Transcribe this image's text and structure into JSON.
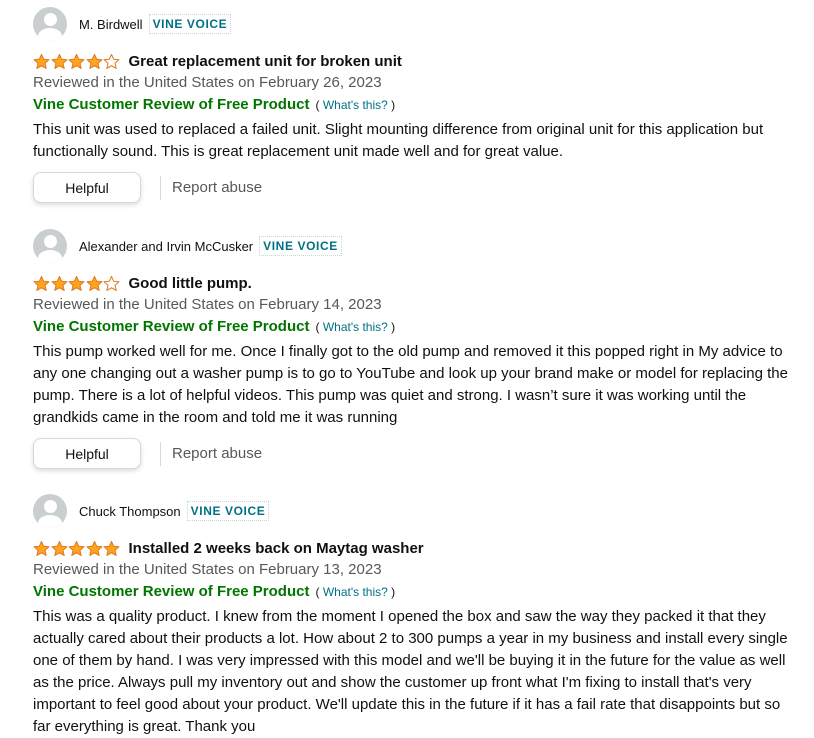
{
  "colors": {
    "star": "#ffa41c",
    "star_outline": "#de7921",
    "vine_badge": "#007185",
    "vine_label": "#007600",
    "date": "#565959"
  },
  "icons": {
    "avatar": "default-avatar-icon",
    "star_full": "star-full-icon",
    "star_empty": "star-empty-icon"
  },
  "reviews": [
    {
      "author": "M. Birdwell",
      "badge": "VINE VOICE",
      "rating": 4,
      "title": "Great replacement unit for broken unit",
      "date": "Reviewed in the United States on February 26, 2023",
      "vine_label": "Vine Customer Review of Free Product",
      "whats_open": "(",
      "whats_link": "What's this?",
      "whats_close": ")",
      "body": "This unit was used to replaced a failed unit. Slight mounting difference from original unit for this application but functionally sound. This is great replacement unit made well and for great value.",
      "helpful_label": "Helpful",
      "report_label": "Report abuse"
    },
    {
      "author": "Alexander and Irvin McCusker",
      "badge": "VINE VOICE",
      "rating": 4,
      "title": "Good little pump.",
      "date": "Reviewed in the United States on February 14, 2023",
      "vine_label": "Vine Customer Review of Free Product",
      "whats_open": "(",
      "whats_link": "What's this?",
      "whats_close": ")",
      "body": "This pump worked well for me. Once I finally got to the old pump and removed it this popped right in My advice to any one changing out a washer pump is to go to YouTube and look up your brand make or model for replacing the pump. There is a lot of helpful videos. This pump was quiet and strong. I wasn’t sure it was working until the grandkids came in the room and told me it was running",
      "helpful_label": "Helpful",
      "report_label": "Report abuse"
    },
    {
      "author": "Chuck Thompson",
      "badge": "VINE VOICE",
      "rating": 5,
      "title": "Installed 2 weeks back on Maytag washer",
      "date": "Reviewed in the United States on February 13, 2023",
      "vine_label": "Vine Customer Review of Free Product",
      "whats_open": "(",
      "whats_link": "What's this?",
      "whats_close": ")",
      "body": "This was a quality product. I knew from the moment I opened the box and saw the way they packed it that they actually cared about their products a lot. How about 2 to 300 pumps a year in my business and install every single one of them by hand. I was very impressed with this model and we'll be buying it in the future for the value as well as the price. Always pull my inventory out and show the customer up front what I'm fixing to install that's very important to feel good about your product. We'll update this in the future if it has a fail rate that disappoints but so far everything is great. Thank you"
    }
  ]
}
